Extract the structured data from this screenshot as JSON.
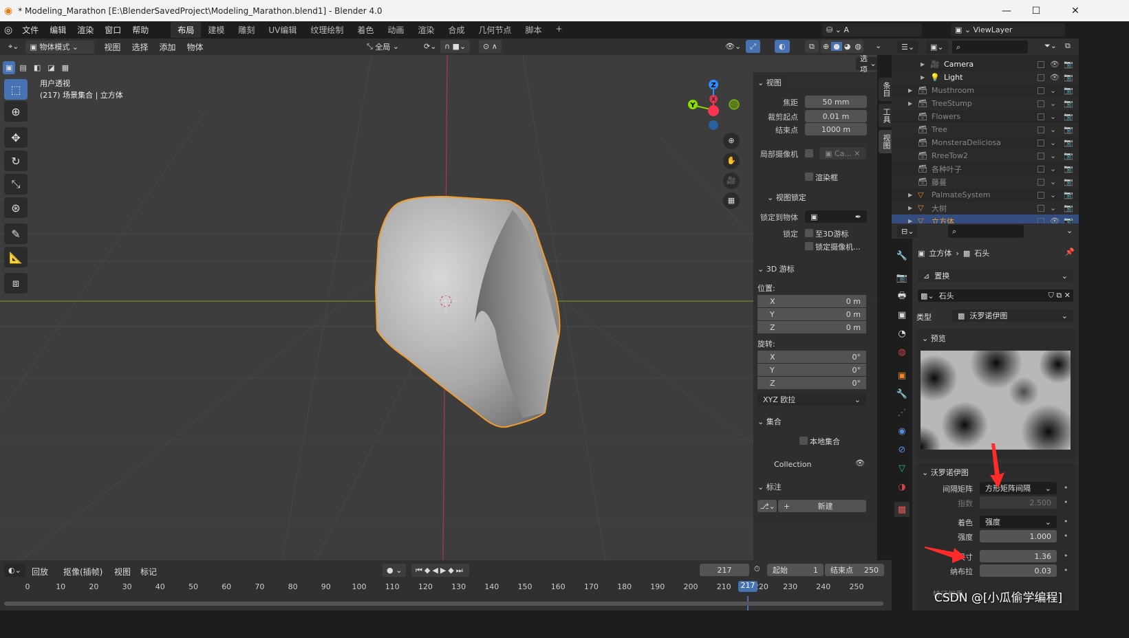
{
  "window": {
    "title": "* Modeling_Marathon [E:\\BlenderSavedProject\\Modeling_Marathon.blend1] - Blender 4.0",
    "minimize": "—",
    "maximize": "☐",
    "close": "✕"
  },
  "menu": [
    "文件",
    "编辑",
    "渲染",
    "窗口",
    "帮助"
  ],
  "workspaces": [
    "布局",
    "建模",
    "雕刻",
    "UV编辑",
    "纹理绘制",
    "着色",
    "动画",
    "渲染",
    "合成",
    "几何节点",
    "脚本",
    "+"
  ],
  "scene": {
    "name": "A",
    "view_layer": "ViewLayer"
  },
  "viewport_header": {
    "mode": "物体模式",
    "menus": [
      "视图",
      "选择",
      "添加",
      "物体"
    ],
    "transform": "全局",
    "options": "选项"
  },
  "viewport": {
    "view_name": "用户透视",
    "info": "(217) 场景集合 | 立方体",
    "gizmo": {
      "z": "Z",
      "y": "Y",
      "x": "X"
    },
    "colors": {
      "x": "#ff3352",
      "y": "#8bdc00",
      "z": "#2890ff",
      "outline": "#f49b2a",
      "selected": "#4772b3"
    }
  },
  "npanel": {
    "view_header": "视图",
    "focal_label": "焦距",
    "focal": "50 mm",
    "clip_start_label": "裁剪起点",
    "clip_start": "0.01 m",
    "clip_end_label": "结束点",
    "clip_end": "1000 m",
    "local_camera_label": "局部摄像机",
    "local_camera": "Ca...",
    "render_region": "渲染框",
    "view_lock_header": "视图锁定",
    "lock_object_label": "锁定到物体",
    "lock_label": "锁定",
    "lock_cursor": "至3D游标",
    "lock_camera": "锁定摄像机...",
    "cursor_header": "3D 游标",
    "location_label": "位置:",
    "loc": [
      {
        "axis": "X",
        "value": "0 m"
      },
      {
        "axis": "Y",
        "value": "0 m"
      },
      {
        "axis": "Z",
        "value": "0 m"
      }
    ],
    "rotation_label": "旋转:",
    "rot": [
      {
        "axis": "X",
        "value": "0°"
      },
      {
        "axis": "Y",
        "value": "0°"
      },
      {
        "axis": "Z",
        "value": "0°"
      }
    ],
    "rotation_mode": "XYZ 欧拉",
    "collection_header": "集合",
    "local_collection": "本地集合",
    "collection_name": "Collection",
    "annotation_header": "标注",
    "new_label": "新建"
  },
  "side_tabs": [
    "条目",
    "工具",
    "视图"
  ],
  "outliner": {
    "rows": [
      {
        "name": "Camera",
        "icon": "camera-icon",
        "indent": 1,
        "active": true
      },
      {
        "name": "Light",
        "icon": "light-icon",
        "indent": 1,
        "active": true
      },
      {
        "name": "Musthroom",
        "icon": "collection-icon",
        "indent": 0
      },
      {
        "name": "TreeStump",
        "icon": "collection-icon",
        "indent": 0
      },
      {
        "name": "Flowers",
        "icon": "collection-icon",
        "indent": 0
      },
      {
        "name": "Tree",
        "icon": "collection-icon",
        "indent": 0
      },
      {
        "name": "MonsteraDeliciosa",
        "icon": "collection-icon",
        "indent": 0
      },
      {
        "name": "RreeTow2",
        "icon": "collection-icon",
        "indent": 0
      },
      {
        "name": "各种叶子",
        "icon": "collection-icon",
        "indent": 0
      },
      {
        "name": "藤蔓",
        "icon": "collection-icon",
        "indent": 0
      },
      {
        "name": "PalmateSystem",
        "icon": "mesh-icon",
        "indent": 0
      },
      {
        "name": "大树",
        "icon": "mesh-icon",
        "indent": 0
      },
      {
        "name": "立方体",
        "icon": "mesh-icon",
        "indent": 0,
        "selected": true
      }
    ]
  },
  "properties": {
    "breadcrumb_object": "立方体",
    "breadcrumb_texture": "石头",
    "modifier": "置换",
    "texture_name": "石头",
    "type_label": "类型",
    "type_value": "沃罗诺伊图",
    "preview_header": "预览",
    "voronoi_header": "沃罗诺伊图",
    "fields": [
      {
        "label": "间隔矩阵",
        "value": "方形矩阵间隔",
        "kind": "dropdown"
      },
      {
        "label": "指数",
        "value": "2.500",
        "kind": "disabled"
      },
      {
        "label": "着色",
        "value": "强度",
        "kind": "dropdown"
      },
      {
        "label": "强度",
        "value": "1.000",
        "kind": "number"
      },
      {
        "label": "尺寸",
        "value": "1.36",
        "kind": "number"
      },
      {
        "label": "纳布拉",
        "value": "0.03",
        "kind": "number"
      }
    ],
    "partial_row": "特征权重"
  },
  "timeline": {
    "menus": [
      "回放",
      "抠像(插帧)",
      "视图",
      "标记"
    ],
    "current_frame": "217",
    "start_label": "起始",
    "start": "1",
    "end_label": "结束点",
    "end": "250",
    "ticks": [
      "0",
      "10",
      "20",
      "30",
      "40",
      "50",
      "60",
      "70",
      "80",
      "90",
      "100",
      "110",
      "120",
      "130",
      "140",
      "150",
      "160",
      "170",
      "180",
      "190",
      "200",
      "210",
      "220",
      "230",
      "240",
      "250"
    ]
  },
  "watermark": "CSDN @[小瓜偷学编程]"
}
